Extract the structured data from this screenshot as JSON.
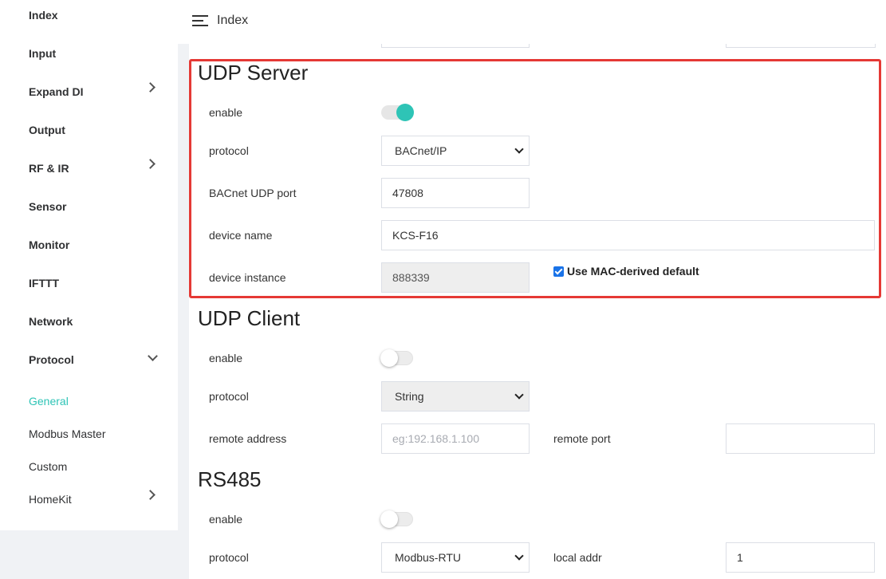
{
  "sidebar": {
    "items": [
      {
        "label": "Index"
      },
      {
        "label": "Input"
      },
      {
        "label": "Expand DI"
      },
      {
        "label": "Output"
      },
      {
        "label": "RF & IR"
      },
      {
        "label": "Sensor"
      },
      {
        "label": "Monitor"
      },
      {
        "label": "IFTTT"
      },
      {
        "label": "Network"
      },
      {
        "label": "Protocol"
      }
    ],
    "protocol_sub": [
      {
        "label": "General",
        "active": true
      },
      {
        "label": "Modbus Master"
      },
      {
        "label": "Custom"
      },
      {
        "label": "HomeKit"
      }
    ]
  },
  "header": {
    "title": "Index"
  },
  "udp_server": {
    "title": "UDP Server",
    "enable_label": "enable",
    "enable": true,
    "protocol_label": "protocol",
    "protocol_value": "BACnet/IP",
    "port_label": "BACnet UDP port",
    "port_value": "47808",
    "device_name_label": "device name",
    "device_name_value": "KCS-F16",
    "device_instance_label": "device instance",
    "device_instance_value": "888339",
    "mac_default_label": "Use MAC-derived default",
    "mac_default_checked": true
  },
  "udp_client": {
    "title": "UDP Client",
    "enable_label": "enable",
    "enable": false,
    "protocol_label": "protocol",
    "protocol_value": "String",
    "remote_address_label": "remote address",
    "remote_address_placeholder": "eg:192.168.1.100",
    "remote_port_label": "remote port",
    "remote_port_value": ""
  },
  "rs485": {
    "title": "RS485",
    "enable_label": "enable",
    "enable": false,
    "protocol_label": "protocol",
    "protocol_value": "Modbus-RTU",
    "local_addr_label": "local addr",
    "local_addr_value": "1"
  },
  "colors": {
    "accent": "#2ec4b6",
    "highlight": "#e53935",
    "checkbox": "#1a73e8"
  }
}
